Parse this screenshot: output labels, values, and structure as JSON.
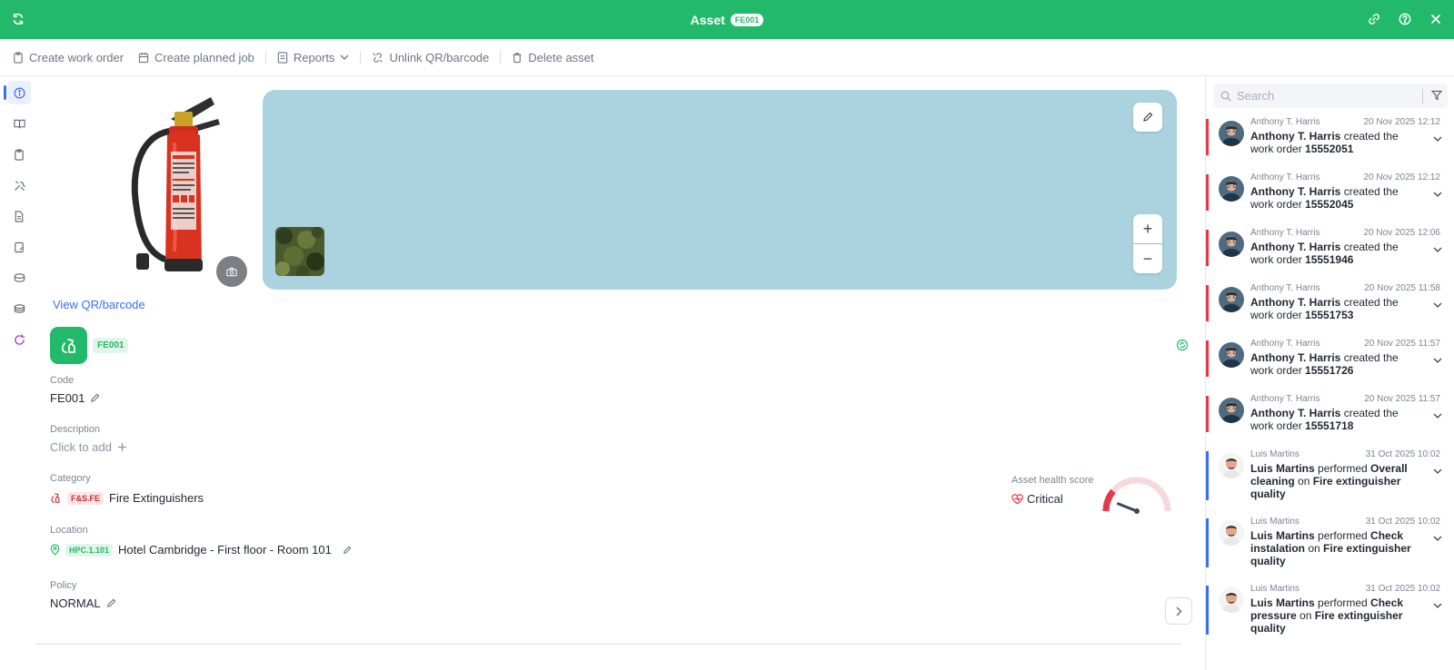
{
  "header": {
    "title": "Asset",
    "badge": "FE001"
  },
  "toolbar": {
    "create_work_order": "Create work order",
    "create_planned_job": "Create planned job",
    "reports": "Reports",
    "unlink_qr": "Unlink QR/barcode",
    "delete_asset": "Delete asset"
  },
  "asset": {
    "view_qr": "View QR/barcode",
    "code_badge": "FE001",
    "code_label": "Code",
    "code_value": "FE001",
    "description_label": "Description",
    "description_value": "Click to add",
    "category_label": "Category",
    "category_tag": "F&S.FE",
    "category_value": "Fire Extinguishers",
    "location_label": "Location",
    "location_tag": "HPC.1.101",
    "location_value": "Hotel Cambridge - First floor - Room 101",
    "policy_label": "Policy",
    "policy_value": "NORMAL",
    "health_label": "Asset health score",
    "health_value": "Critical",
    "health_level": 0.12
  },
  "map": {
    "zoom_in": "+",
    "zoom_out": "−"
  },
  "activity": {
    "search_placeholder": "Search",
    "entries": [
      {
        "author": "Anthony T. Harris",
        "date": "20 Nov 2025 12:12",
        "who": "Anthony T. Harris",
        "action": " created the work order ",
        "target": "15552051"
      },
      {
        "author": "Anthony T. Harris",
        "date": "20 Nov 2025 12:12",
        "who": "Anthony T. Harris",
        "action": " created the work order ",
        "target": "15552045"
      },
      {
        "author": "Anthony T. Harris",
        "date": "20 Nov 2025 12:06",
        "who": "Anthony T. Harris",
        "action": " created the work order ",
        "target": "15551946"
      },
      {
        "author": "Anthony T. Harris",
        "date": "20 Nov 2025 11:58",
        "who": "Anthony T. Harris",
        "action": " created the work order ",
        "target": "15551753"
      },
      {
        "author": "Anthony T. Harris",
        "date": "20 Nov 2025 11:57",
        "who": "Anthony T. Harris",
        "action": " created the work order ",
        "target": "15551726"
      },
      {
        "author": "Anthony T. Harris",
        "date": "20 Nov 2025 11:57",
        "who": "Anthony T. Harris",
        "action": " created the work order ",
        "target": "15551718"
      },
      {
        "author": "Luis Martins",
        "date": "31 Oct 2025 10:02",
        "who": "Luis Martins",
        "action": " performed ",
        "task": "Overall cleaning",
        "on": " on ",
        "target": "Fire extinguisher quality"
      },
      {
        "author": "Luis Martins",
        "date": "31 Oct 2025 10:02",
        "who": "Luis Martins",
        "action": " performed ",
        "task": "Check instalation",
        "on": " on ",
        "target": "Fire extinguisher quality"
      },
      {
        "author": "Luis Martins",
        "date": "31 Oct 2025 10:02",
        "who": "Luis Martins",
        "action": " performed ",
        "task": "Check pressure",
        "on": " on ",
        "target": "Fire extinguisher quality"
      }
    ]
  },
  "colors": {
    "brand": "#22b96a",
    "link": "#3b6ef0",
    "critical": "#e5394a"
  }
}
